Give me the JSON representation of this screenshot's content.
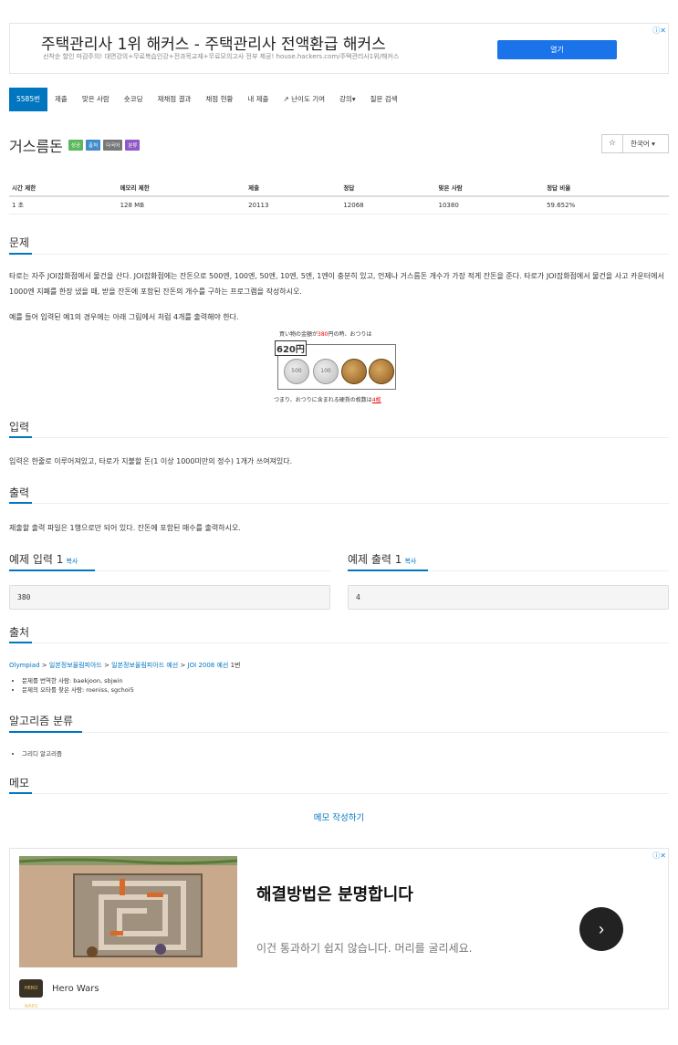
{
  "ad_top": {
    "title": "주택관리사 1위 해커스 - 주택관리사 전액환급 해커스",
    "desc": "선착순 할인 마감주의! 대면강의+무료복습인강+전과목교재+무료모의고사 전부 제공! house.hackers.com/주택관리사1위/해커스",
    "button": "열기",
    "adchoice": "ⓘ✕"
  },
  "nav": {
    "items": [
      "5585번",
      "제출",
      "맞은 사람",
      "숏코딩",
      "재채점 결과",
      "채점 현황",
      "내 제출",
      "난이도 기여",
      "강의▾",
      "질문 검색"
    ]
  },
  "problem": {
    "title": "거스름돈",
    "badges": [
      "성공",
      "출처",
      "다국어",
      "분류"
    ],
    "star": "☆",
    "language": "한국어"
  },
  "info_table": {
    "headers": [
      "시간 제한",
      "메모리 제한",
      "제출",
      "정답",
      "맞은 사람",
      "정답 비율"
    ],
    "row": [
      "1 초",
      "128 MB",
      "20113",
      "12068",
      "10380",
      "59.652%"
    ]
  },
  "sections": {
    "problem": "문제",
    "input": "입력",
    "output": "출력",
    "source": "출처",
    "algorithm": "알고리즘 분류",
    "memo": "메모"
  },
  "description": {
    "p1": "타로는 자주 JOI잡화점에서 물건을 산다. JOI잡화점에는 잔돈으로 500엔, 100엔, 50엔, 10엔, 5엔, 1엔이 충분히 있고, 언제나 거스름돈 개수가 가장 적게 잔돈을 준다. 타로가 JOI잡화점에서 물건을 사고 카운터에서 1000엔 지폐를 한장 냈을 때, 받을 잔돈에 포함된 잔돈의 개수를 구하는 프로그램을 작성하시오.",
    "p2": "예를 들어 입력된 예1의 경우에는 아래 그림에서 처럼 4개를 출력해야 한다.",
    "fig_cap1_a": "買い物の金額が",
    "fig_cap1_red": "380",
    "fig_cap1_b": "円の時、おつりは",
    "fig_price": "620円",
    "fig_coin_500": "500",
    "fig_coin_100": "100",
    "fig_cap2_a": "つまり、おつりに含まれる硬貨の枚数は",
    "fig_cap2_red": "4枚",
    "input": "입력은 한줄로 이루어져있고, 타로가 지불할 돈(1 이상 1000미만의 정수) 1개가 쓰여져있다.",
    "output": "제출할 출력 파일은 1행으로만 되어 있다. 잔돈에 포함된 매수를 출력하시오."
  },
  "samples": {
    "input_title": "예제 입력 1",
    "output_title": "예제 출력 1",
    "copy": "복사",
    "input_value": "380",
    "output_value": "4"
  },
  "source": {
    "path": [
      "Olympiad",
      "일본정보올림피아드",
      "일본정보올림피아드 예선",
      "JOI 2008 예선"
    ],
    "sep": " > ",
    "suffix": " 1번",
    "translator": "문제를 번역한 사람: baekjoon, sbjwin",
    "typo": "문제의 오타를 찾은 사람: roeniss, sgchoi5"
  },
  "algorithm": {
    "items": [
      "그리디 알고리즘"
    ]
  },
  "memo": {
    "link": "메모 작성하기"
  },
  "ad_bottom": {
    "headline": "해결방법은 분명합니다",
    "desc": "이건 통과하기 쉽지 않습니다. 머리를 굴리세요.",
    "brand": "Hero Wars",
    "logo": "HERO WARS",
    "adchoice": "ⓘ✕",
    "go": "›"
  },
  "colors": {
    "accent": "#0076c0",
    "success": "#5cb85c",
    "ad_button": "#1a73e8"
  }
}
